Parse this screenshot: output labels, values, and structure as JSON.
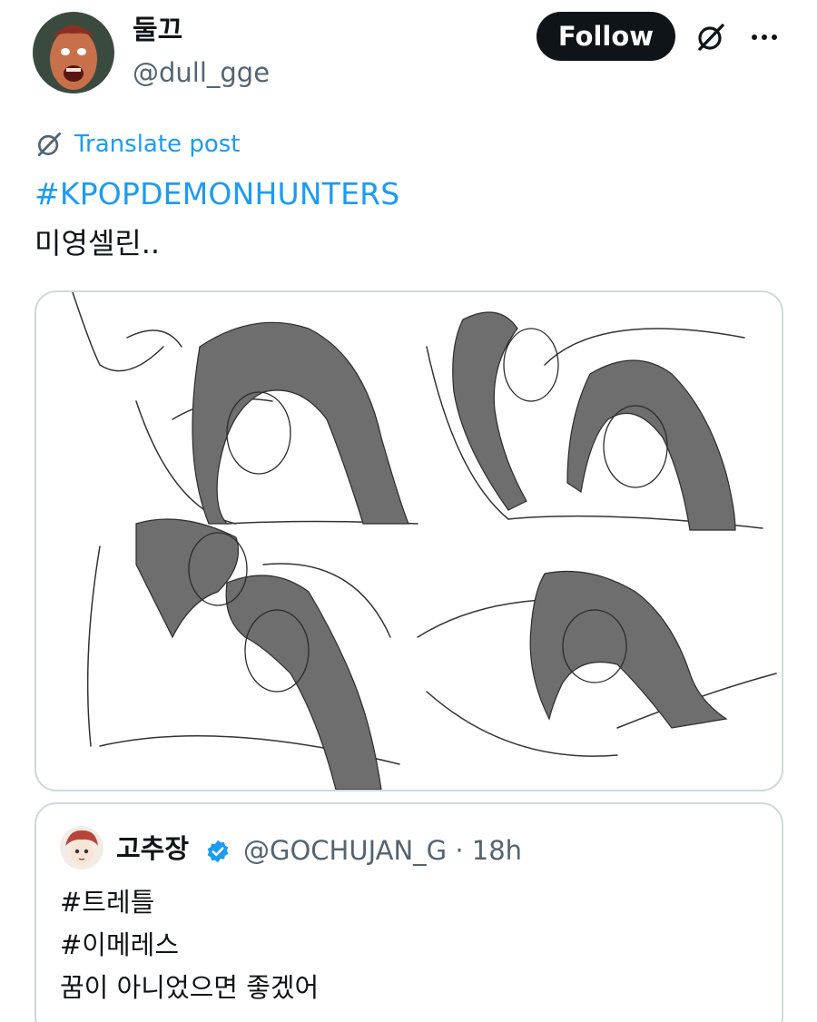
{
  "author": {
    "display_name": "둘끄",
    "handle": "@dull_gge",
    "avatar_icon": "avatar-demon-icon"
  },
  "actions": {
    "follow_label": "Follow",
    "grok_icon": "grok-icon",
    "more_icon": "more-icon"
  },
  "translate": {
    "label": "Translate post",
    "icon": "translate-icon"
  },
  "post": {
    "hashtag": "#KPOPDEMONHUNTERS",
    "text": "미영셀린.."
  },
  "media": {
    "type": "sketch-illustration"
  },
  "quoted_post": {
    "display_name": "고추장",
    "handle_time": "@GOCHUJAN_G · 18h",
    "verified_icon": "verified-badge-icon",
    "lines": [
      "#트레틀",
      "#이메레스",
      "꿈이 아니었으면 좋겠어"
    ]
  },
  "colors": {
    "accent": "#1d9bf0",
    "text_primary": "#0f1419",
    "text_secondary": "#536471",
    "border": "#cfd9de"
  }
}
